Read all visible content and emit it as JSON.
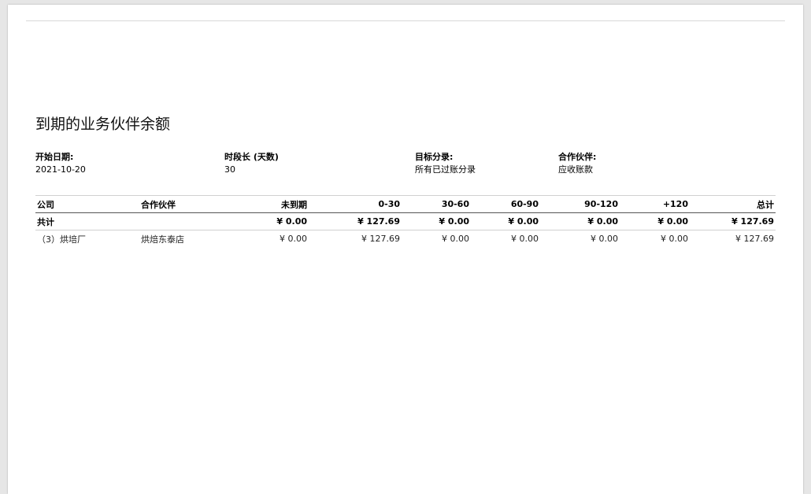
{
  "report": {
    "title": "到期的业务伙伴余额"
  },
  "filters": {
    "start_date": {
      "label": "开始日期:",
      "value": "2021-10-20"
    },
    "period_length": {
      "label": "时段长 (天数)",
      "value": "30"
    },
    "target_moves": {
      "label": "目标分录:",
      "value": "所有已过账分录"
    },
    "partners": {
      "label": "合作伙伴:",
      "value": "应收账款"
    }
  },
  "table": {
    "headers": [
      "公司",
      "合作伙伴",
      "未到期",
      "0-30",
      "30-60",
      "60-90",
      "90-120",
      "+120",
      "总计"
    ],
    "total_row": {
      "label": "共计",
      "partner": "",
      "not_due": "¥ 0.00",
      "b0_30": "¥ 127.69",
      "b30_60": "¥ 0.00",
      "b60_90": "¥ 0.00",
      "b90_120": "¥ 0.00",
      "b120": "¥ 0.00",
      "total": "¥ 127.69"
    },
    "rows": [
      {
        "company": "（3）烘培厂",
        "partner": "烘焙东泰店",
        "not_due": "¥ 0.00",
        "b0_30": "¥ 127.69",
        "b30_60": "¥ 0.00",
        "b60_90": "¥ 0.00",
        "b90_120": "¥ 0.00",
        "b120": "¥ 0.00",
        "total": "¥ 127.69"
      }
    ]
  }
}
